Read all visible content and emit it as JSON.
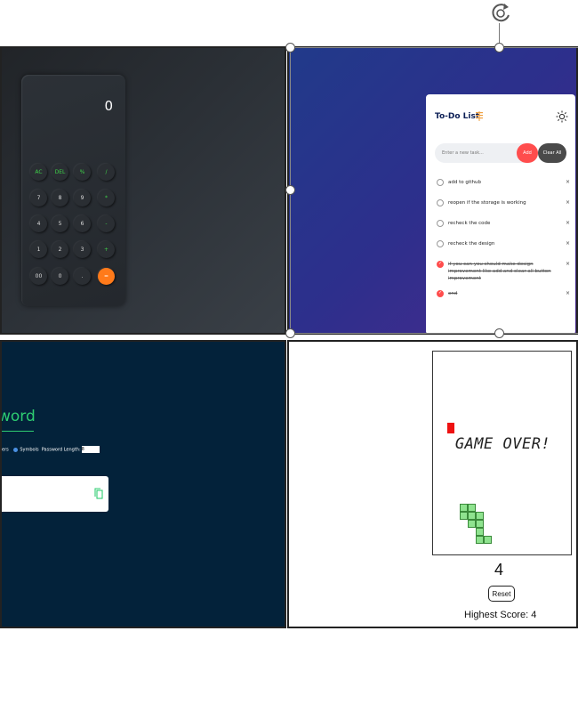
{
  "calculator": {
    "display": "0",
    "keys": [
      {
        "label": "AC",
        "style": "green"
      },
      {
        "label": "DEL",
        "style": "green"
      },
      {
        "label": "%",
        "style": "green"
      },
      {
        "label": "/",
        "style": "green"
      },
      {
        "label": "7",
        "style": "plain"
      },
      {
        "label": "8",
        "style": "plain"
      },
      {
        "label": "9",
        "style": "plain"
      },
      {
        "label": "*",
        "style": "green"
      },
      {
        "label": "4",
        "style": "plain"
      },
      {
        "label": "5",
        "style": "plain"
      },
      {
        "label": "6",
        "style": "plain"
      },
      {
        "label": "-",
        "style": "green"
      },
      {
        "label": "1",
        "style": "plain"
      },
      {
        "label": "2",
        "style": "plain"
      },
      {
        "label": "3",
        "style": "plain"
      },
      {
        "label": "+",
        "style": "green"
      },
      {
        "label": "00",
        "style": "plain"
      },
      {
        "label": "0",
        "style": "plain"
      },
      {
        "label": ".",
        "style": "plain"
      },
      {
        "label": "=",
        "style": "orange"
      }
    ]
  },
  "todo": {
    "title": "To-Do List",
    "input_placeholder": "Enter a new task...",
    "add_label": "Add",
    "clear_label": "Clear All",
    "items": [
      {
        "text": "add to github",
        "done": false
      },
      {
        "text": "reopen if the storage is working",
        "done": false
      },
      {
        "text": "recheck the code",
        "done": false
      },
      {
        "text": "recheck the design",
        "done": false
      },
      {
        "text": "if you can you should make design improvement like add and clear all button improvement",
        "done": true
      },
      {
        "text": "end",
        "done": true
      }
    ],
    "delete_glyph": "×"
  },
  "password": {
    "title_visible": "word",
    "options_text": "ers",
    "symbols_label": "Symbols",
    "length_label": "Password Length:",
    "length_value": "8"
  },
  "game": {
    "message": "GAME OVER!",
    "score": "4",
    "reset_label": "Reset",
    "highest_score": "Highest Score: 4"
  },
  "colors": {
    "accent_green": "#2ecc71",
    "todo_red": "#ff4d4d",
    "calc_orange": "#ff7a1a"
  }
}
